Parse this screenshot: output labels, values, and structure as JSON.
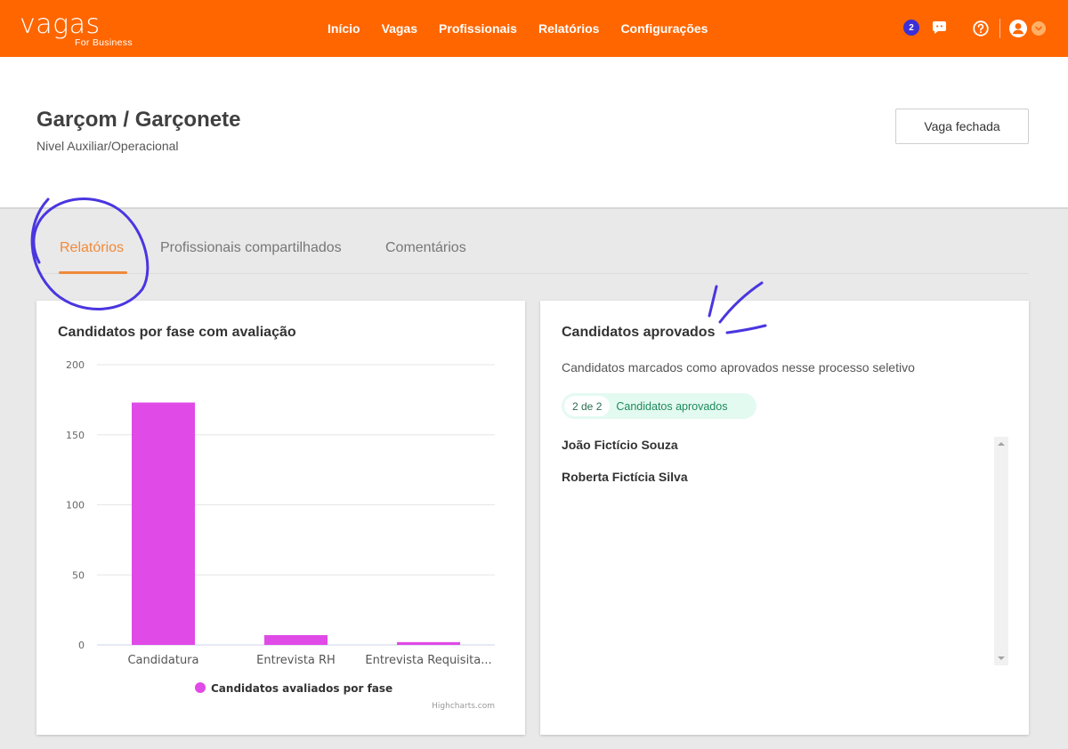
{
  "brand": {
    "name": "vagas",
    "sub": "For Business"
  },
  "nav": {
    "items": [
      "Início",
      "Vagas",
      "Profissionais",
      "Relatórios",
      "Configurações"
    ]
  },
  "notifications": {
    "count": "2"
  },
  "job": {
    "title": "Garçom / Garçonete",
    "level": "Nivel Auxiliar/Operacional",
    "status_button": "Vaga fechada"
  },
  "tabs": {
    "items": [
      "Relatórios",
      "Profissionais compartilhados",
      "Comentários"
    ],
    "active": "Relatórios"
  },
  "chart_card": {
    "title": "Candidatos por fase com avaliação",
    "credit": "Highcharts.com"
  },
  "chart_data": {
    "type": "bar",
    "title": "Candidatos por fase com avaliação",
    "categories": [
      "Candidatura",
      "Entrevista RH",
      "Entrevista Requisita..."
    ],
    "series": [
      {
        "name": "Candidatos avaliados por fase",
        "values": [
          173,
          7,
          2
        ],
        "color": "#e04ae6"
      }
    ],
    "ylim": [
      0,
      200
    ],
    "yticks": [
      "0",
      "50",
      "100",
      "150",
      "200"
    ],
    "grid": true,
    "legend": "bottom-center"
  },
  "approved_card": {
    "title": "Candidatos aprovados",
    "subtitle": "Candidatos marcados como aprovados nesse processo seletivo",
    "count": "2 de 2",
    "count_label": "Candidatos aprovados",
    "candidates": [
      "João Fictício Souza",
      "Roberta Fictícia Silva"
    ]
  },
  "colors": {
    "brand": "#ff6600",
    "accent": "#f08a3a",
    "annotation": "#4a36e0",
    "bar": "#e04ae6",
    "pill_bg": "#e3faf1"
  }
}
